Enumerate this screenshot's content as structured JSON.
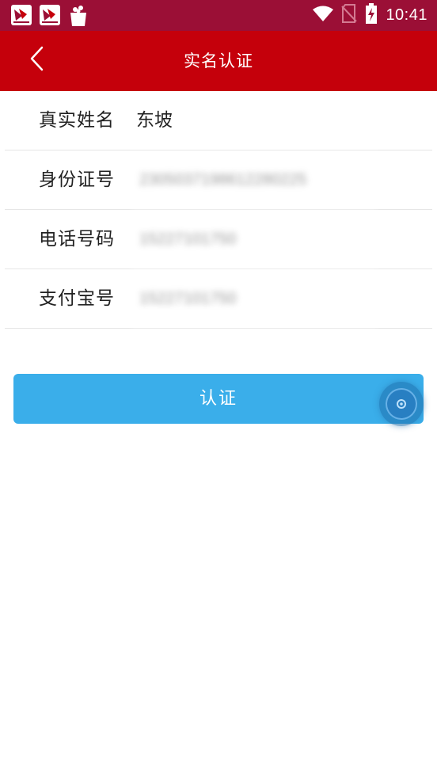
{
  "status_bar": {
    "time": "10:41",
    "icons": [
      "app-notification-icon",
      "app-notification-icon",
      "shopping-bag-icon",
      "wifi-icon",
      "no-sim-icon",
      "battery-charging-icon"
    ]
  },
  "header": {
    "title": "实名认证",
    "back_icon": "chevron-left-icon"
  },
  "form": {
    "fields": [
      {
        "label": "真实姓名",
        "value": "东坡"
      },
      {
        "label": "身份证号",
        "value": "2305037198612280225"
      },
      {
        "label": "电话号码",
        "value": "15227101750"
      },
      {
        "label": "支付宝号",
        "value": "15227101750"
      }
    ]
  },
  "submit": {
    "label": "认证"
  },
  "colors": {
    "status_bar": "#9b0f36",
    "title_bar": "#c5000b",
    "button": "#3aaeea",
    "divider": "#e6e6e6"
  }
}
